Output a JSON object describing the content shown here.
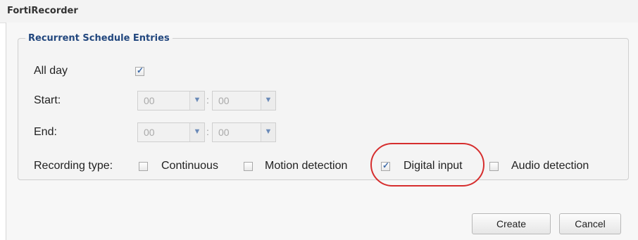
{
  "window": {
    "title": "FortiRecorder"
  },
  "group": {
    "legend": "Recurrent Schedule Entries"
  },
  "all_day": {
    "label": "All day",
    "checked": true
  },
  "start": {
    "label": "Start:",
    "hour": "00",
    "minute": "00",
    "separator": ":"
  },
  "end": {
    "label": "End:",
    "hour": "00",
    "minute": "00",
    "separator": ":"
  },
  "recording_type": {
    "label": "Recording type:",
    "options": [
      {
        "label": "Continuous",
        "checked": false
      },
      {
        "label": "Motion detection",
        "checked": false
      },
      {
        "label": "Digital input",
        "checked": true
      },
      {
        "label": "Audio detection",
        "checked": false
      }
    ]
  },
  "buttons": {
    "create": "Create",
    "cancel": "Cancel"
  },
  "colors": {
    "legend": "#22477e",
    "highlight": "#d62e2e",
    "check": "#3d6aa8"
  },
  "icons": {
    "dropdown": "chevron-down-icon",
    "check": "checkmark-icon"
  }
}
